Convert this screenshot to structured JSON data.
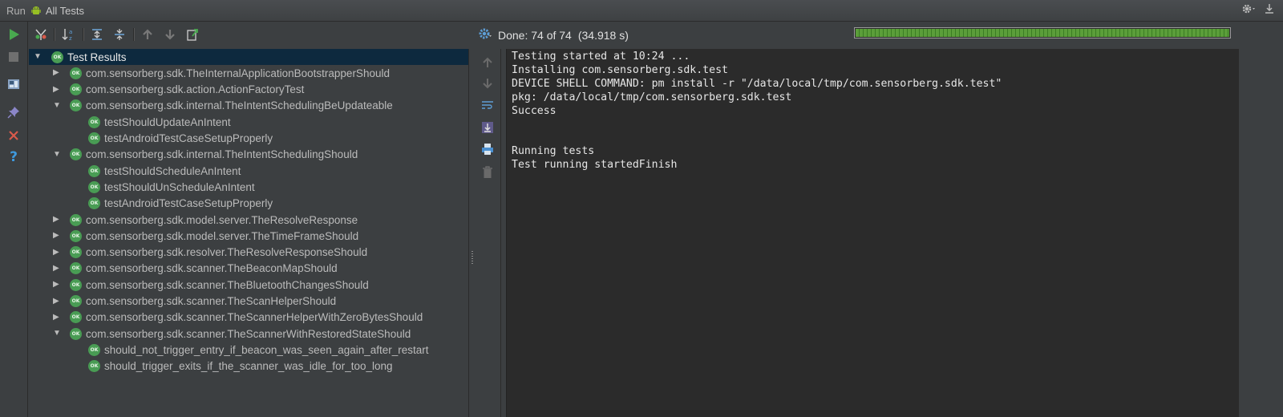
{
  "title_bar": {
    "run_label": "Run",
    "config_name": "All Tests",
    "icons": [
      "android-icon",
      "gear-icon",
      "download-icon"
    ]
  },
  "toolbar": {
    "status_text": "Done: 74 of 74",
    "duration_text": "(34.918 s)",
    "progress_fraction": 1.0,
    "progress_color": "#5b9e3a"
  },
  "left_sidebar": {
    "icons": [
      "run-icon",
      "stop-icon",
      "layout-icon",
      "pin-icon",
      "close-icon",
      "help-icon"
    ]
  },
  "tree": {
    "root": {
      "label": "Test Results",
      "badge": "OK"
    },
    "rows": [
      {
        "label": "com.sensorberg.sdk.TheInternalApplicationBootstrapperShould",
        "badge": "OK",
        "level": 1,
        "expanded": false
      },
      {
        "label": "com.sensorberg.sdk.action.ActionFactoryTest",
        "badge": "OK",
        "level": 1,
        "expanded": false
      },
      {
        "label": "com.sensorberg.sdk.internal.TheIntentSchedulingBeUpdateable",
        "badge": "OK",
        "level": 1,
        "expanded": true
      },
      {
        "label": "testShouldUpdateAnIntent",
        "badge": "OK",
        "level": 2
      },
      {
        "label": "testAndroidTestCaseSetupProperly",
        "badge": "OK",
        "level": 2
      },
      {
        "label": "com.sensorberg.sdk.internal.TheIntentSchedulingShould",
        "badge": "OK",
        "level": 1,
        "expanded": true
      },
      {
        "label": "testShouldScheduleAnIntent",
        "badge": "OK",
        "level": 2
      },
      {
        "label": "testShouldUnScheduleAnIntent",
        "badge": "OK",
        "level": 2
      },
      {
        "label": "testAndroidTestCaseSetupProperly",
        "badge": "OK",
        "level": 2
      },
      {
        "label": "com.sensorberg.sdk.model.server.TheResolveResponse",
        "badge": "OK",
        "level": 1,
        "expanded": false
      },
      {
        "label": "com.sensorberg.sdk.model.server.TheTimeFrameShould",
        "badge": "OK",
        "level": 1,
        "expanded": false
      },
      {
        "label": "com.sensorberg.sdk.resolver.TheResolveResponseShould",
        "badge": "OK",
        "level": 1,
        "expanded": false
      },
      {
        "label": "com.sensorberg.sdk.scanner.TheBeaconMapShould",
        "badge": "OK",
        "level": 1,
        "expanded": false
      },
      {
        "label": "com.sensorberg.sdk.scanner.TheBluetoothChangesShould",
        "badge": "OK",
        "level": 1,
        "expanded": false
      },
      {
        "label": "com.sensorberg.sdk.scanner.TheScanHelperShould",
        "badge": "OK",
        "level": 1,
        "expanded": false
      },
      {
        "label": "com.sensorberg.sdk.scanner.TheScannerHelperWithZeroBytesShould",
        "badge": "OK",
        "level": 1,
        "expanded": false
      },
      {
        "label": "com.sensorberg.sdk.scanner.TheScannerWithRestoredStateShould",
        "badge": "OK",
        "level": 1,
        "expanded": true
      },
      {
        "label": "should_not_trigger_entry_if_beacon_was_seen_again_after_restart",
        "badge": "OK",
        "level": 2
      },
      {
        "label": "should_trigger_exits_if_the_scanner_was_idle_for_too_long",
        "badge": "OK",
        "level": 2
      }
    ]
  },
  "console": {
    "lines": [
      "Testing started at 10:24 ...",
      "Installing com.sensorberg.sdk.test",
      "DEVICE SHELL COMMAND: pm install -r \"/data/local/tmp/com.sensorberg.sdk.test\"",
      "pkg: /data/local/tmp/com.sensorberg.sdk.test",
      "Success",
      "",
      "",
      "Running tests",
      "Test running startedFinish"
    ]
  }
}
